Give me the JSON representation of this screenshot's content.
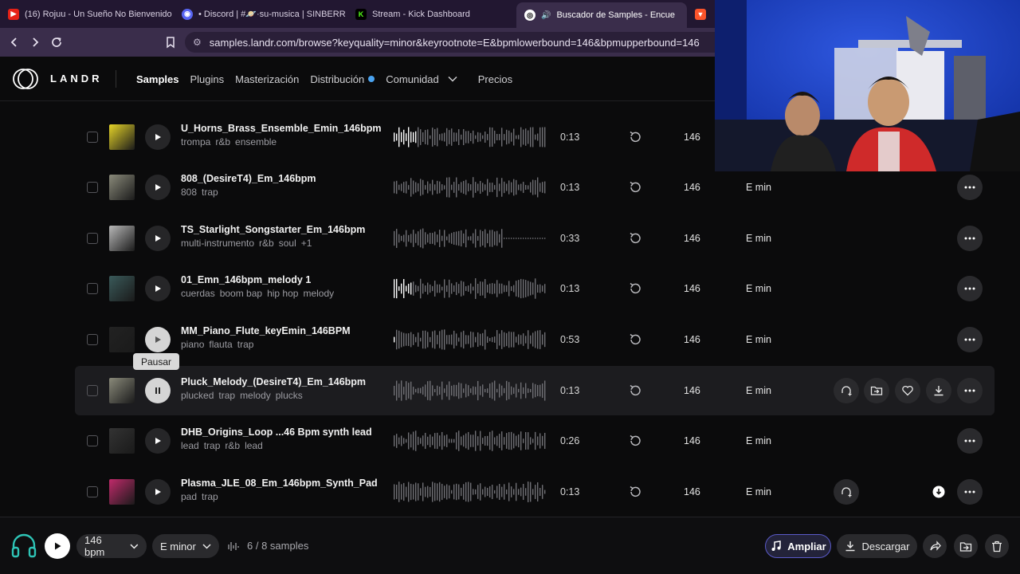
{
  "browser": {
    "tabs": [
      {
        "title": "(16) Rojuu - Un Sueño No Bienvenido",
        "icon": "youtube-icon",
        "color": "#e62117"
      },
      {
        "title": "• Discord | #🪐·su-musica | SINBERR",
        "icon": "discord-icon",
        "color": "#5865f2"
      },
      {
        "title": "Stream - Kick Dashboard",
        "icon": "kick-icon",
        "color": "#53fc18"
      },
      {
        "title": "Buscador de Samples - Encue",
        "icon": "landr-icon",
        "color": "#ffffff",
        "active": true
      },
      {
        "title": "",
        "icon": "brave-icon",
        "color": "#fb542b"
      }
    ],
    "url": "samples.landr.com/browse?keyquality=minor&keyrootnote=E&bpmlowerbound=146&bpmupperbound=146"
  },
  "site": {
    "logo": "LANDR",
    "nav": [
      {
        "label": "Samples",
        "active": true
      },
      {
        "label": "Plugins"
      },
      {
        "label": "Masterización"
      },
      {
        "label": "Distribución",
        "dot": true
      },
      {
        "label": "Comunidad",
        "dropdown": true
      },
      {
        "label": "Precios"
      }
    ]
  },
  "samples": [
    {
      "title": "U_Horns_Brass_Ensemble_Emin_146bpm",
      "tags": [
        "trompa",
        "r&b",
        "ensemble"
      ],
      "duration": "0:13",
      "bpm": "146",
      "key": "",
      "thumb": "#e6d428"
    },
    {
      "title": "808_(DesireT4)_Em_146bpm",
      "tags": [
        "808",
        "trap"
      ],
      "duration": "0:13",
      "bpm": "146",
      "key": "E min",
      "thumb": "#8a8a7a"
    },
    {
      "title": "TS_Starlight_Songstarter_Em_146bpm",
      "tags": [
        "multi-instrumento",
        "r&b",
        "soul",
        "+1"
      ],
      "duration": "0:33",
      "bpm": "146",
      "key": "E min",
      "thumb": "#b8b8b8"
    },
    {
      "title": "01_Emn_146bpm_melody 1",
      "tags": [
        "cuerdas",
        "boom bap",
        "hip hop",
        "melody"
      ],
      "duration": "0:13",
      "bpm": "146",
      "key": "E min",
      "thumb": "#3a5a5a"
    },
    {
      "title": "MM_Piano_Flute_keyEmin_146BPM",
      "tags": [
        "piano",
        "flauta",
        "trap"
      ],
      "duration": "0:53",
      "bpm": "146",
      "key": "E min",
      "thumb": "#222"
    },
    {
      "title": "Pluck_Melody_(DesireT4)_Em_146bpm",
      "tags": [
        "plucked",
        "trap",
        "melody",
        "plucks"
      ],
      "duration": "0:13",
      "bpm": "146",
      "key": "E min",
      "thumb": "#8a8a7a"
    },
    {
      "title": "DHB_Origins_Loop ...46 Bpm synth lead",
      "tags": [
        "lead",
        "trap",
        "r&b",
        "lead"
      ],
      "duration": "0:26",
      "bpm": "146",
      "key": "E min",
      "thumb": "#333"
    },
    {
      "title": "Plasma_JLE_08_Em_146bpm_Synth_Pad",
      "tags": [
        "pad",
        "trap"
      ],
      "duration": "0:13",
      "bpm": "146",
      "key": "E min",
      "thumb": "#c02a6a"
    }
  ],
  "tooltip": "Pausar",
  "bottom": {
    "bpm": "146 bpm",
    "key": "E minor",
    "count": "6 / 8 samples",
    "ampliar": "Ampliar",
    "descargar": "Descargar"
  }
}
